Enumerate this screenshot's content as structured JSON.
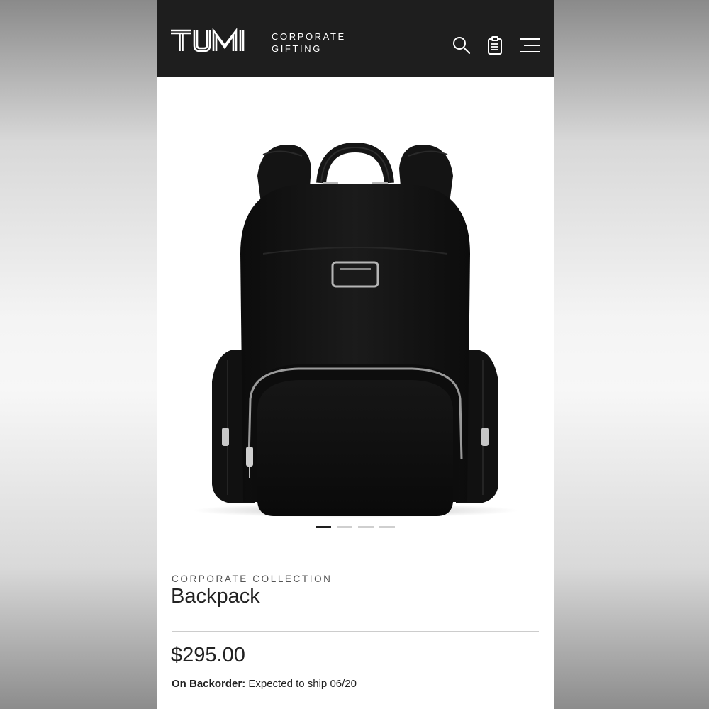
{
  "header": {
    "brand": "TUMI",
    "subtitle_line1": "CORPORATE",
    "subtitle_line2": "GIFTING",
    "icons": [
      "search-icon",
      "clipboard-icon",
      "menu-icon"
    ],
    "background": "#1e1e1e"
  },
  "carousel": {
    "image": "black-backpack",
    "slides": 4,
    "active_slide": 1
  },
  "product": {
    "collection": "CORPORATE COLLECTION",
    "name": "Backpack",
    "price": "$295.00",
    "status_label": "On Backorder:",
    "status_text": " Expected to ship 06/20"
  }
}
